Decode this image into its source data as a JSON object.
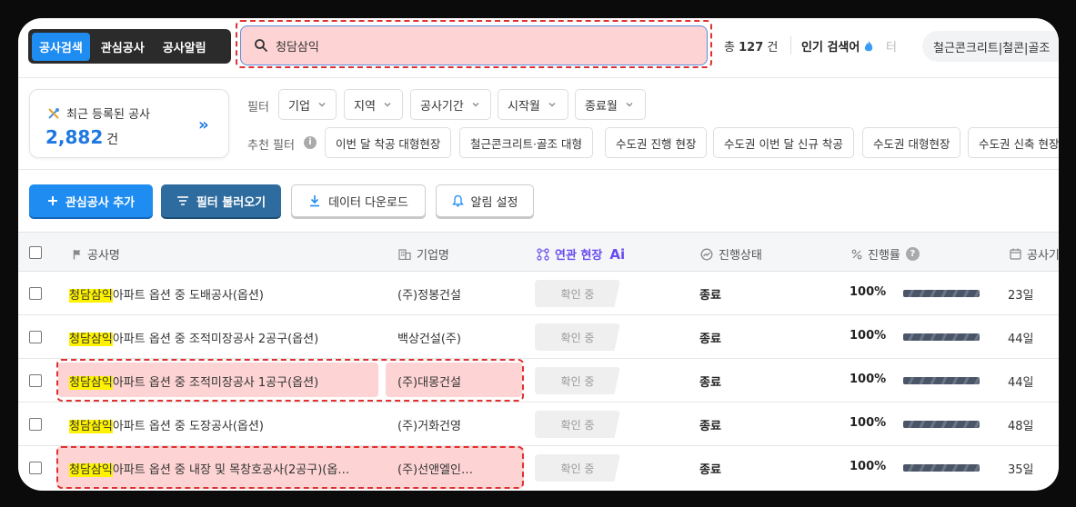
{
  "tabs": [
    "공사검색",
    "관심공사",
    "공사알림"
  ],
  "search": {
    "value": "청담삼익"
  },
  "total": {
    "prefix": "총",
    "count": "127",
    "unit": "건"
  },
  "popular": {
    "label": "인기 검색어",
    "faded": "터",
    "keyword": "철근콘크리트|철콘|골조"
  },
  "recent": {
    "label": "최근 등록된 공사",
    "count": "2,882",
    "unit": "건"
  },
  "filter": {
    "label": "필터",
    "dropdowns": [
      "기업",
      "지역",
      "공사기간",
      "시작월",
      "종료월"
    ],
    "rec_label": "추천 필터",
    "chips": [
      "이번 달 착공 대형현장",
      "철근콘크리트·골조 대형",
      "수도권 진행 현장",
      "수도권 이번 달 신규 착공",
      "수도권 대형현장",
      "수도권 신축 현장"
    ]
  },
  "actions": {
    "add": "관심공사 추가",
    "load": "필터 불러오기",
    "download": "데이터 다운로드",
    "alert": "알림 설정"
  },
  "columns": {
    "name": "공사명",
    "company": "기업명",
    "related": "연관 현장",
    "related_ai": "Ai",
    "status": "진행상태",
    "progress": "진행률",
    "period": "공사기"
  },
  "rows": [
    {
      "name_hl": "청담삼익",
      "name_rest": "아파트 옵션 중 도배공사(옵션)",
      "company": "(주)정봉건설",
      "badge": "확인 중",
      "status": "종료",
      "progress": "100%",
      "days": "23일"
    },
    {
      "name_hl": "청담삼익",
      "name_rest": "아파트 옵션 중 조적미장공사 2공구(옵션)",
      "company": "백상건설(주)",
      "badge": "확인 중",
      "status": "종료",
      "progress": "100%",
      "days": "44일"
    },
    {
      "name_hl": "청담삼익",
      "name_rest": "아파트 옵션 중 조적미장공사 1공구(옵션)",
      "company": "(주)대몽건설",
      "badge": "확인 중",
      "status": "종료",
      "progress": "100%",
      "days": "44일"
    },
    {
      "name_hl": "청담삼익",
      "name_rest": "아파트 옵션 중 도장공사(옵션)",
      "company": "(주)거화건영",
      "badge": "확인 중",
      "status": "종료",
      "progress": "100%",
      "days": "48일"
    },
    {
      "name_hl": "청담삼익",
      "name_rest": "아파트 옵션 중 내장 및 목창호공사(2공구)(옵…",
      "company": "(주)선앤엘인…",
      "badge": "확인 중",
      "status": "종료",
      "progress": "100%",
      "days": "35일"
    }
  ],
  "colors": {
    "accent": "#1e8cf0",
    "dark_button": "#2e6b9e",
    "highlight": "#fff200",
    "ai": "#6a4cf0",
    "annotation": "#e03030"
  }
}
